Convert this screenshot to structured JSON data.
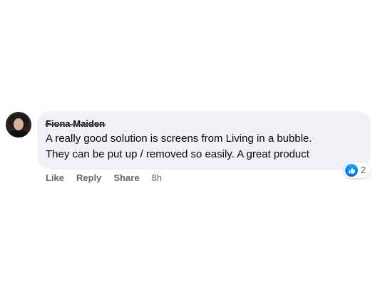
{
  "comment": {
    "author": "Fiona Maiden",
    "text": "A really good solution is screens from Living in a bubble.\nThey can be put up / removed so easily. A great product",
    "reactions": {
      "icon": "like-icon",
      "count": "2",
      "color": "#1877f2"
    },
    "actions": {
      "like": "Like",
      "reply": "Reply",
      "share": "Share"
    },
    "timestamp": "8h"
  }
}
